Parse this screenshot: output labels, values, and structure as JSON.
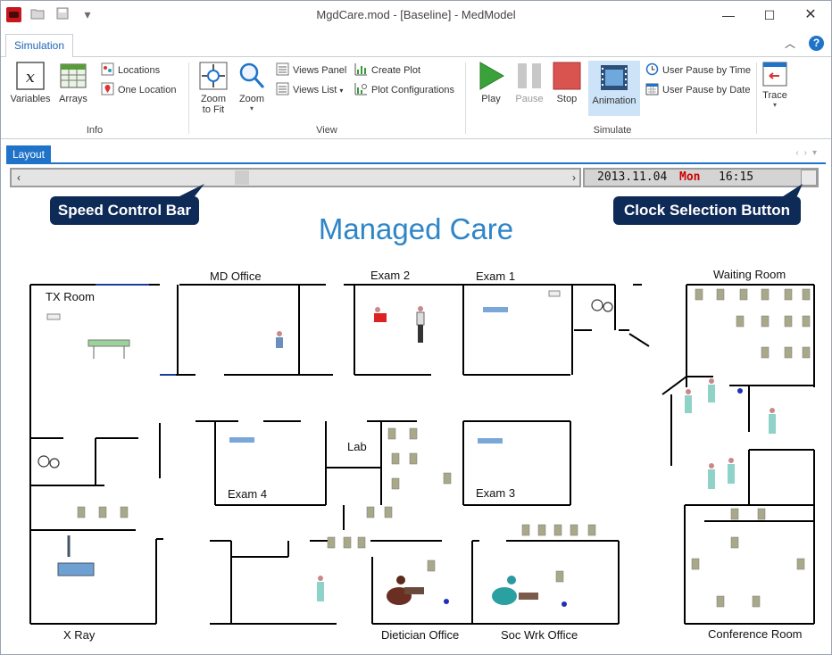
{
  "window": {
    "title": "MgdCare.mod - [Baseline] - MedModel"
  },
  "quick_access": {
    "open_icon": "folder-icon",
    "save_icon": "save-icon",
    "more": "▾"
  },
  "ribbon": {
    "active_tab": "Simulation",
    "groups": {
      "info": {
        "label": "Info",
        "variables": "Variables",
        "arrays": "Arrays",
        "locations": "Locations",
        "one_location": "One Location"
      },
      "view": {
        "label": "View",
        "zoom_to_fit": "Zoom to Fit",
        "zoom": "Zoom",
        "views_panel": "Views Panel",
        "views_list": "Views List",
        "create_plot": "Create Plot",
        "plot_configurations": "Plot Configurations"
      },
      "simulate": {
        "label": "Simulate",
        "play": "Play",
        "pause": "Pause",
        "stop": "Stop",
        "animation": "Animation",
        "user_pause_time": "User Pause by Time",
        "user_pause_date": "User Pause by Date"
      },
      "trace": {
        "label": "Trace"
      }
    }
  },
  "document_tab": "Layout",
  "clock": {
    "date": "2013.11.04",
    "day": "Mon",
    "time": "16:15"
  },
  "callouts": {
    "speed": "Speed Control Bar",
    "clock": "Clock Selection Button"
  },
  "layout": {
    "title": "Managed Care",
    "rooms": {
      "tx_room": "TX Room",
      "md_office": "MD Office",
      "exam2": "Exam 2",
      "exam1": "Exam 1",
      "waiting": "Waiting Room",
      "lab": "Lab",
      "exam4": "Exam 4",
      "exam3": "Exam 3",
      "xray": "X Ray",
      "dietician": "Dietician Office",
      "socwrk": "Soc Wrk Office",
      "conference": "Conference Room"
    }
  },
  "colors": {
    "accent": "#1f73c9",
    "title_blue": "#2e85c8",
    "callout_bg": "#0e2a57",
    "play_green": "#3aa23a",
    "stop_red": "#d9534f",
    "day_red": "#d00000"
  }
}
